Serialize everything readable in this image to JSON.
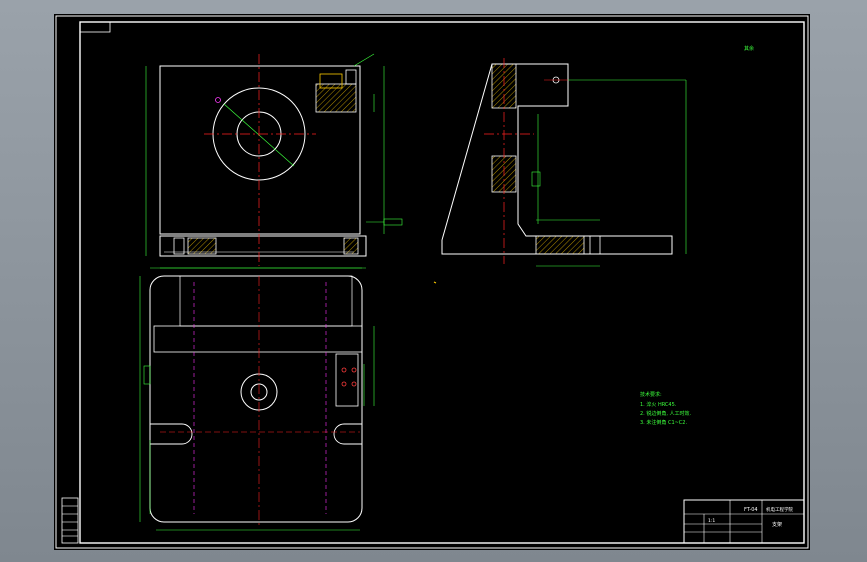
{
  "title_block": {
    "scale": "1:1",
    "part_name": "支架",
    "drawing_no": "FT-04",
    "unit": "机电工程学院"
  },
  "tech_notes": {
    "heading": "技术要求:",
    "items": [
      "1. 淬火 HRC45.",
      "2. 锐边倒角, 人工时效.",
      "3. 未注倒角 C1~C2."
    ]
  },
  "roughness_mark": "其余",
  "colors": {
    "background": "#000000",
    "outline": "#ffffff",
    "dimension": "#22ff22",
    "centerline": "#ff2222",
    "hidden": "#ff33ff",
    "title_block": "#ffffff"
  }
}
